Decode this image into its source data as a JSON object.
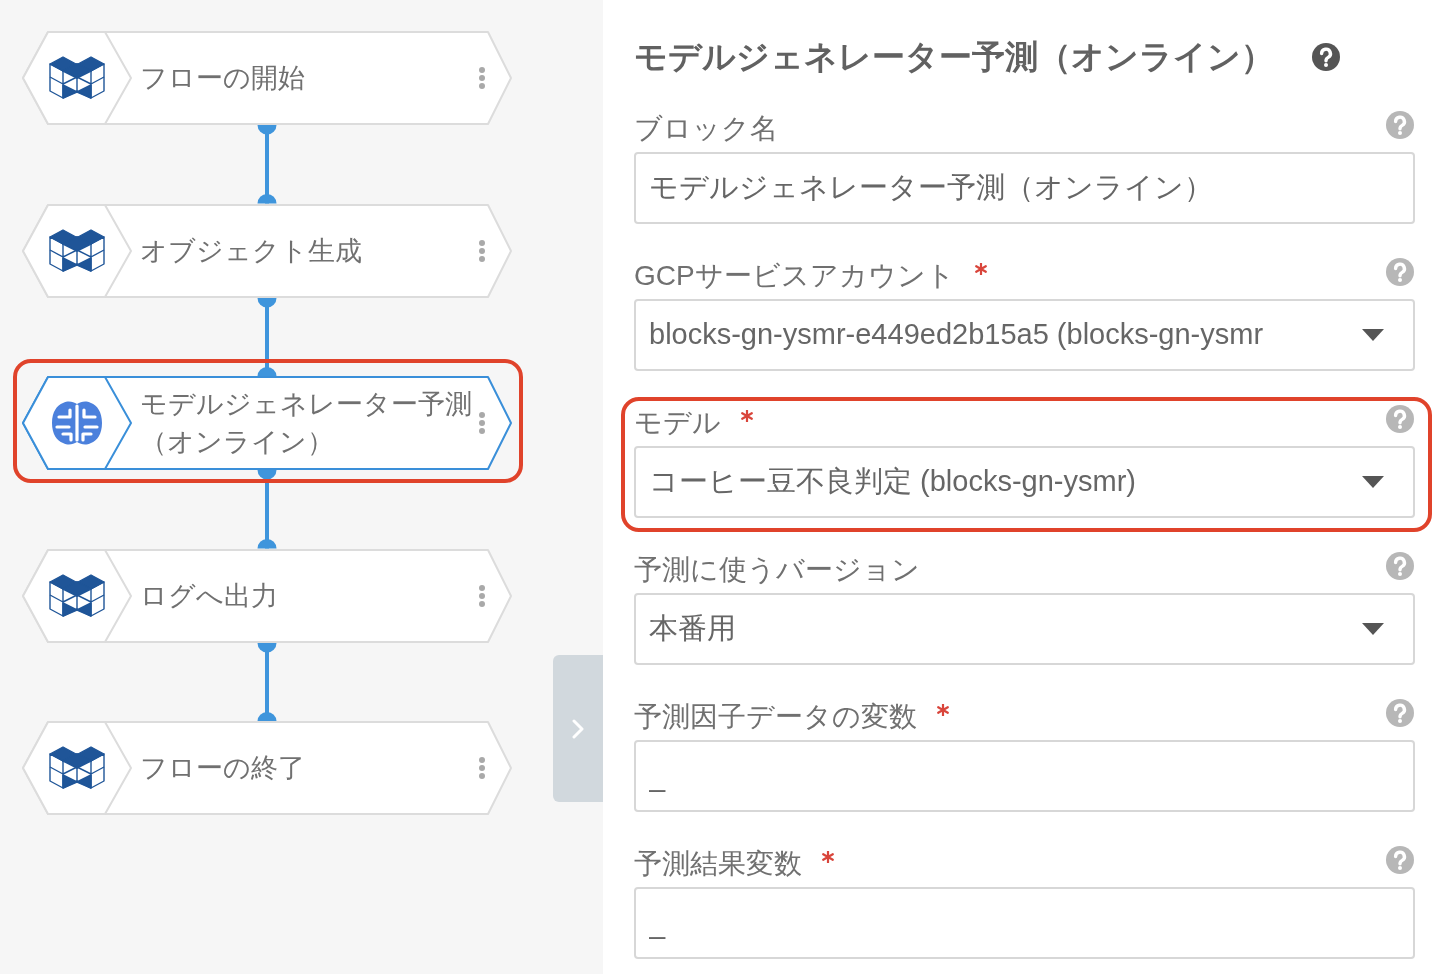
{
  "flow": {
    "blocks": [
      {
        "label": "フローの開始",
        "kind": "basic",
        "selected": false,
        "highlighted": false
      },
      {
        "label": "オブジェクト生成",
        "kind": "basic",
        "selected": false,
        "highlighted": false
      },
      {
        "label": "モデルジェネレーター予測（オンライン）",
        "kind": "ai",
        "selected": true,
        "highlighted": true
      },
      {
        "label": "ログへ出力",
        "kind": "basic",
        "selected": false,
        "highlighted": false
      },
      {
        "label": "フローの終了",
        "kind": "basic",
        "selected": false,
        "highlighted": false
      }
    ]
  },
  "properties": {
    "title": "モデルジェネレーター予測（オンライン）",
    "fields": [
      {
        "label": "ブロック名",
        "kind": "text",
        "required": false,
        "highlighted": false,
        "value": "モデルジェネレーター予測（オンライン）"
      },
      {
        "label": "GCPサービスアカウント",
        "kind": "select",
        "required": true,
        "highlighted": false,
        "value": "blocks-gn-ysmr-e449ed2b15a5 (blocks-gn-ysmr"
      },
      {
        "label": "モデル",
        "kind": "select",
        "required": true,
        "highlighted": true,
        "value": "コーヒー豆不良判定 (blocks-gn-ysmr)"
      },
      {
        "label": "予測に使うバージョン",
        "kind": "select",
        "required": false,
        "highlighted": false,
        "value": "本番用"
      },
      {
        "label": "予測因子データの変数",
        "kind": "text",
        "required": true,
        "highlighted": false,
        "value": "_"
      },
      {
        "label": "予測結果変数",
        "kind": "text",
        "required": true,
        "highlighted": false,
        "value": "_"
      }
    ]
  }
}
